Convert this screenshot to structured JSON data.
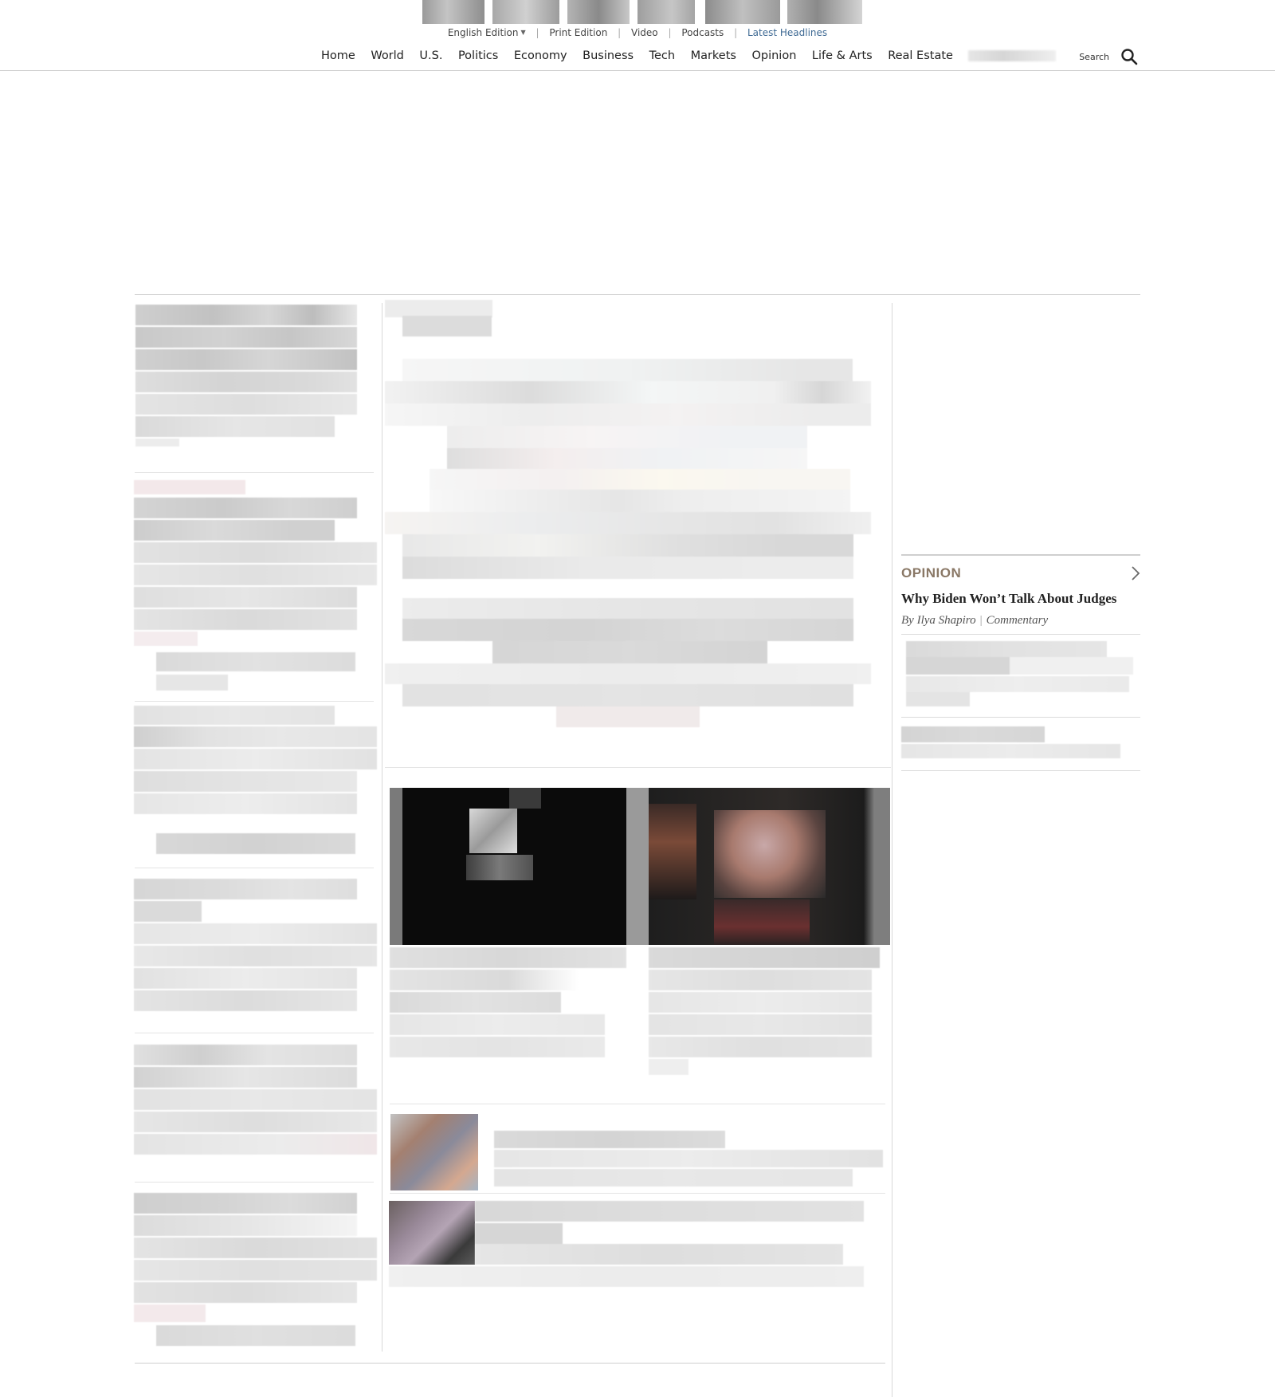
{
  "header": {
    "edition_bar": {
      "edition_label": "English Edition",
      "print_edition": "Print Edition",
      "video": "Video",
      "podcasts": "Podcasts",
      "latest_headlines": "Latest Headlines"
    },
    "nav": [
      "Home",
      "World",
      "U.S.",
      "Politics",
      "Economy",
      "Business",
      "Tech",
      "Markets",
      "Opinion",
      "Life & Arts",
      "Real Estate"
    ],
    "search_label": "Search"
  },
  "opinion": {
    "section_label": "OPINION",
    "headline": "Why Biden Won’t Talk About Judges",
    "byline_author": "By Ilya Shapiro",
    "byline_type": "Commentary"
  },
  "colors": {
    "accent_link": "#3f6a94",
    "opinion_label": "#8a7866",
    "rule": "#cfcfcf"
  }
}
